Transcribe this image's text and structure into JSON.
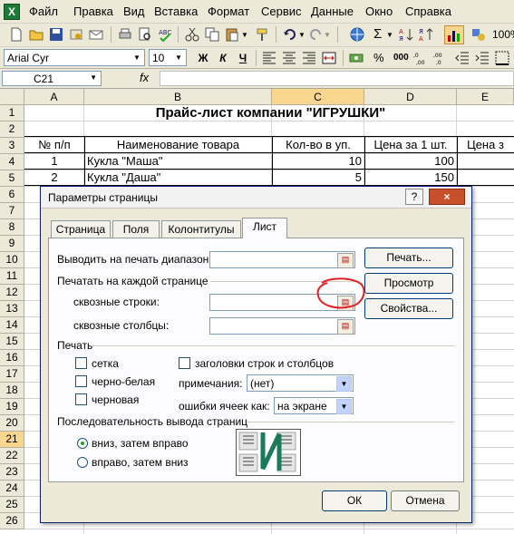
{
  "menu": [
    "Файл",
    "Правка",
    "Вид",
    "Вставка",
    "Формат",
    "Сервис",
    "Данные",
    "Окно",
    "Справка"
  ],
  "toolbar": {
    "zoom": "100%"
  },
  "format_toolbar": {
    "font": "Arial Cyr",
    "size": "10",
    "bold": "Ж",
    "italic": "К",
    "underline": "Ч"
  },
  "formula_bar": {
    "name_box": "C21",
    "fx": "fx"
  },
  "columns": [
    "A",
    "B",
    "C",
    "D",
    "E"
  ],
  "selected_column": "C",
  "rows": [
    "1",
    "2",
    "3",
    "4",
    "5",
    "6",
    "7",
    "8",
    "9",
    "10",
    "11",
    "12",
    "13",
    "14",
    "15",
    "16",
    "17",
    "18",
    "19",
    "20",
    "21",
    "22",
    "23",
    "24",
    "25",
    "26"
  ],
  "selected_row": "21",
  "sheet": {
    "title": "Прайс-лист компании \"ИГРУШКИ\"",
    "headers": {
      "a": "№ п/п",
      "b": "Наименование товара",
      "c": "Кол-во в уп.",
      "d": "Цена за 1 шт.",
      "e": "Цена з"
    },
    "row4": {
      "a": "1",
      "b": "Кукла \"Маша\"",
      "c": "10",
      "d": "100"
    },
    "row5": {
      "a": "2",
      "b": "Кукла \"Даша\"",
      "c": "5",
      "d": "150"
    }
  },
  "dialog": {
    "title": "Параметры страницы",
    "help": "?",
    "close": "×",
    "tabs": [
      "Страница",
      "Поля",
      "Колонтитулы",
      "Лист"
    ],
    "active_tab": "Лист",
    "print_area_label": "Выводить на печать диапазон:",
    "print_titles_label": "Печатать на каждой странице",
    "rows_label": "сквозные строки:",
    "cols_label": "сквозные столбцы:",
    "print_label": "Печать",
    "gridlines": "сетка",
    "black_white": "черно-белая",
    "draft": "черновая",
    "row_col_headings": "заголовки строк и столбцов",
    "comments_label": "примечания:",
    "comments_value": "(нет)",
    "errors_label": "ошибки ячеек как:",
    "errors_value": "на экране",
    "order_label": "Последовательность вывода страниц",
    "down_then_over": "вниз, затем вправо",
    "over_then_down": "вправо, затем вниз",
    "btn_print": "Печать...",
    "btn_preview": "Просмотр",
    "btn_options": "Свойства...",
    "btn_ok": "ОК",
    "btn_cancel": "Отмена"
  }
}
